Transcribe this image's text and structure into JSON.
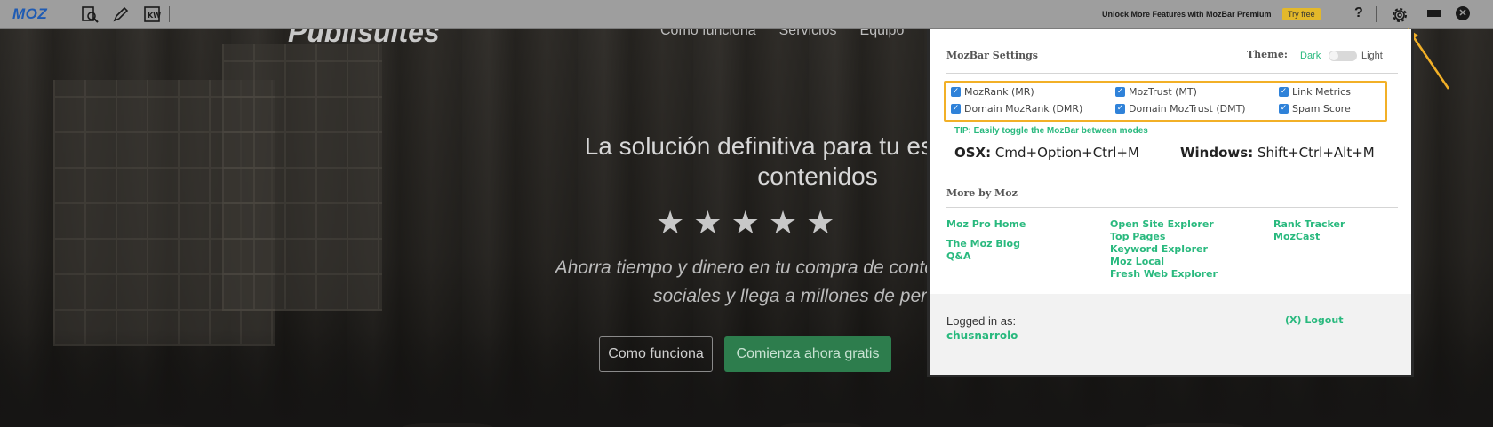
{
  "site": {
    "logo": "Publisuites",
    "nav": [
      "Como funciona",
      "Servicios",
      "Equipo"
    ],
    "hero_title_line1": "La solución definitiva para tu estrategia de",
    "hero_title_line2": "contenidos",
    "hero_sub_line1": "Ahorra tiempo y dinero en tu compra de contenidos, difusión en",
    "hero_sub_line2": "sociales y llega a millones de personas.",
    "btn_how": "Como funciona",
    "btn_start": "Comienza ahora gratis"
  },
  "mozbar": {
    "logo": "MOZ",
    "premium_text": "Unlock More Features with MozBar Premium",
    "try_free": "Try free",
    "help": "?",
    "icons": [
      "page-analysis-icon",
      "highlighter-icon",
      "keyword-icon",
      "gear-icon",
      "minimize-icon",
      "close-icon"
    ],
    "accent_color": "#29b97e"
  },
  "panel": {
    "title": "MozBar Settings",
    "theme_label": "Theme:",
    "theme_dark": "Dark",
    "theme_light": "Light",
    "metrics": [
      {
        "label": "MozRank (MR)",
        "checked": true
      },
      {
        "label": "MozTrust (MT)",
        "checked": true
      },
      {
        "label": "Link Metrics",
        "checked": true
      },
      {
        "label": "Domain MozRank (DMR)",
        "checked": true
      },
      {
        "label": "Domain MozTrust (DMT)",
        "checked": true
      },
      {
        "label": "Spam Score",
        "checked": true
      }
    ],
    "tip": "TIP: Easily toggle the MozBar between modes",
    "osx_label": "OSX:",
    "osx_keys": "Cmd+Option+Ctrl+M",
    "win_label": "Windows:",
    "win_keys": "Shift+Ctrl+Alt+M",
    "more_title": "More by Moz",
    "links": {
      "col1": [
        "Moz Pro Home",
        "The Moz Blog",
        "Q&A"
      ],
      "col2": [
        "Open Site Explorer",
        "Top Pages",
        "Keyword Explorer",
        "Moz Local",
        "Fresh Web Explorer"
      ],
      "col3": [
        "Rank Tracker",
        "MozCast"
      ]
    },
    "logged_label": "Logged in as:",
    "username": "chusnarrolo",
    "logout": "(X) Logout"
  }
}
